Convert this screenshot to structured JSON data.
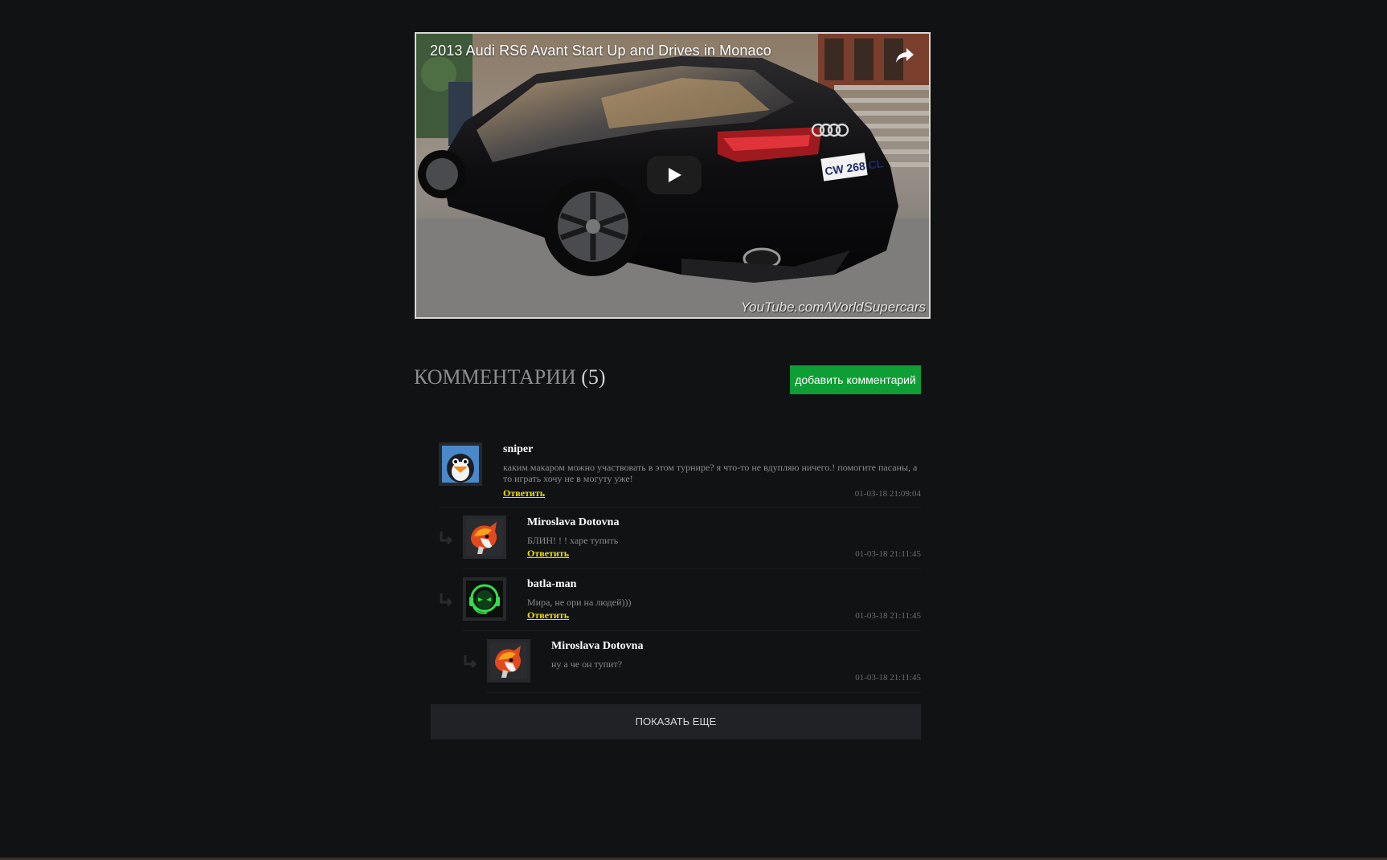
{
  "video": {
    "title": "2013 Audi RS6 Avant Start Up and Drives in Monaco",
    "watermark": "YouTube.com/WorldSupercars",
    "plate": "CW 268 CL",
    "icons": {
      "share": "share-icon",
      "play": "play-icon"
    }
  },
  "comments_header": {
    "title": "КОММЕНТАРИИ",
    "count": "(5)",
    "add_button_label": "добавить комментарий",
    "add_button_color": "#0f9d35"
  },
  "comments": [
    {
      "author": "sniper",
      "text": "каким макаром можно участвовать в этом турнире? я что-то не вдупляю ничего.! помогите пасаны, а то играть хочу не в могуту уже!",
      "reply_label": "Ответить",
      "timestamp": "01-03-18 21:09:04",
      "avatar": "penguin-avatar"
    },
    {
      "author": "Miroslava Dotovna",
      "text": "БЛИН! ! ! харе тупить",
      "reply_label": "Ответить",
      "timestamp": "01-03-18 21:11:45",
      "avatar": "fox-avatar"
    },
    {
      "author": "batla-man",
      "text": "Мира, не ори на людей)))",
      "reply_label": "Ответить",
      "timestamp": "01-03-18 21:11:45",
      "avatar": "alien-headset-avatar"
    },
    {
      "author": "Miroslava Dotovna",
      "text": "ну а че он тупит?",
      "timestamp": "01-03-18 21:11:45",
      "avatar": "fox-avatar"
    }
  ],
  "show_more_label": "ПОКАЗАТЬ ЕЩЕ",
  "colors": {
    "background": "#111214",
    "reply_link": "#f1e10e",
    "button_dark": "#212226"
  }
}
